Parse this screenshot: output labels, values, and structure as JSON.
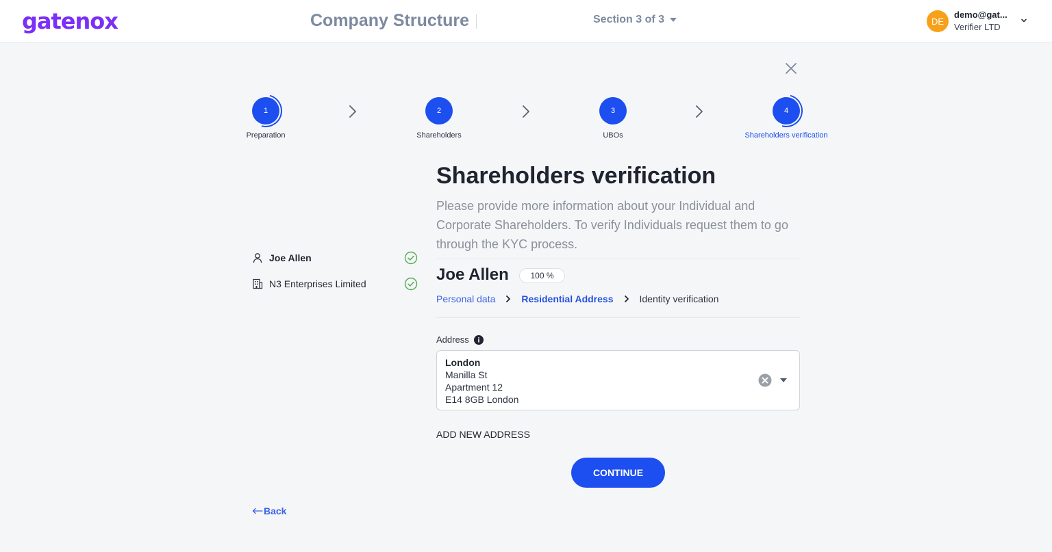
{
  "header": {
    "logo": "gatenox",
    "title": "Company Structure",
    "section": "Section 3 of 3",
    "user": {
      "initials": "DE",
      "email": "demo@gat...",
      "org": "Verifier LTD"
    }
  },
  "stepper": {
    "steps": [
      {
        "number": "1",
        "label": "Preparation"
      },
      {
        "number": "2",
        "label": "Shareholders"
      },
      {
        "number": "3",
        "label": "UBOs"
      },
      {
        "number": "4",
        "label": "Shareholders verification"
      }
    ],
    "active_step": "4"
  },
  "entities": [
    {
      "name": "Joe Allen",
      "type": "person",
      "status": "verified"
    },
    {
      "name": "N3 Enterprises Limited",
      "type": "company",
      "status": "verified"
    }
  ],
  "main": {
    "title": "Shareholders verification",
    "description": "Please provide more information about your Individual and Corporate Shareholders. To verify Individuals request them to go through the KYC process.",
    "person_name": "Joe Allen",
    "percent": "100 %",
    "breadcrumbs": [
      "Personal data",
      "Residential Address",
      "Identity verification"
    ],
    "address_label": "Address",
    "address": {
      "city": "London",
      "line1": "Manilla St",
      "line2": "Apartment 12",
      "line3": "E14 8GB London"
    },
    "add_address": "ADD NEW ADDRESS",
    "continue": "CONTINUE",
    "back": "Back"
  },
  "colors": {
    "primary": "#1c4ef0",
    "brand": "#7b2ff7",
    "success": "#4caf50",
    "avatar": "#f7a11a"
  }
}
